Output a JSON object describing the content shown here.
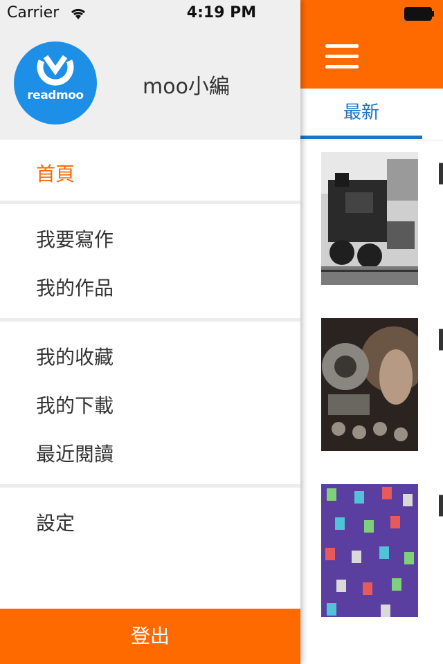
{
  "status_bar": {
    "carrier": "Carrier",
    "time": "4:19 PM"
  },
  "drawer": {
    "avatar_logo_text": "readmoo",
    "username": "moo小編",
    "menu": [
      {
        "label": "首頁",
        "active": true
      },
      {
        "label": "我要寫作"
      },
      {
        "label": "我的作品"
      },
      {
        "label": "我的收藏"
      },
      {
        "label": "我的下載"
      },
      {
        "label": "最近閱讀"
      },
      {
        "label": "設定"
      }
    ],
    "logout_label": "登出"
  },
  "main": {
    "tab_latest": "最新",
    "accent_color": "#ff6a00",
    "tab_color": "#1a74c9"
  }
}
